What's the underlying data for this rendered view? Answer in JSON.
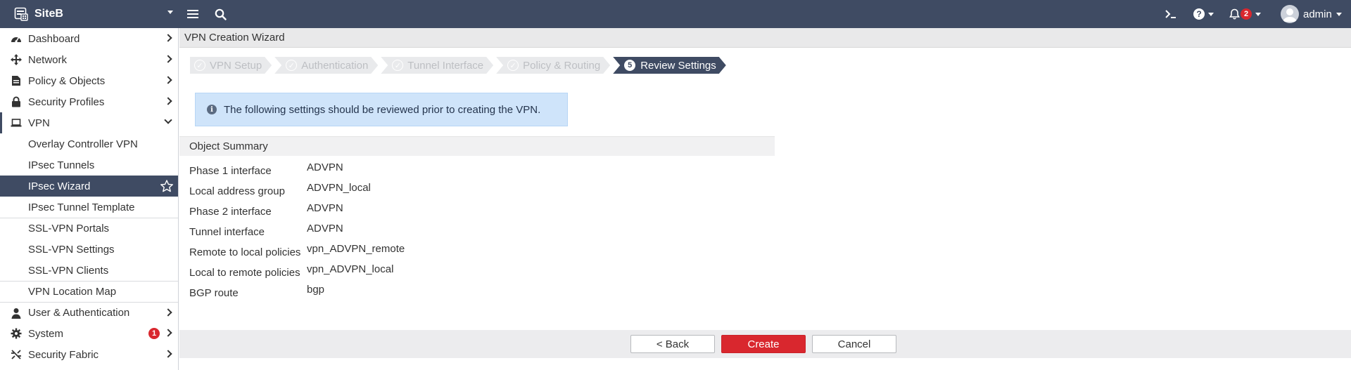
{
  "topbar": {
    "site_name": "SiteB",
    "notification_count": "2",
    "user_name": "admin"
  },
  "sidebar": {
    "items": [
      {
        "label": "Dashboard",
        "icon": "dashboard-icon"
      },
      {
        "label": "Network",
        "icon": "network-icon"
      },
      {
        "label": "Policy & Objects",
        "icon": "policy-icon"
      },
      {
        "label": "Security Profiles",
        "icon": "lock-icon"
      },
      {
        "label": "VPN",
        "icon": "laptop-icon"
      }
    ],
    "vpn_sub": [
      "Overlay Controller VPN",
      "IPsec Tunnels",
      "IPsec Wizard",
      "IPsec Tunnel Template",
      "SSL-VPN Portals",
      "SSL-VPN Settings",
      "SSL-VPN Clients",
      "VPN Location Map"
    ],
    "bottom_items": [
      {
        "label": "User & Authentication",
        "icon": "user-icon"
      },
      {
        "label": "System",
        "icon": "gear-icon",
        "badge": "1"
      },
      {
        "label": "Security Fabric",
        "icon": "fabric-icon"
      }
    ]
  },
  "main": {
    "page_title": "VPN Creation Wizard",
    "steps": [
      {
        "label": "VPN Setup",
        "done": true
      },
      {
        "label": "Authentication",
        "done": true
      },
      {
        "label": "Tunnel Interface",
        "done": true
      },
      {
        "label": "Policy & Routing",
        "done": true
      },
      {
        "label": "Review Settings",
        "number": "5",
        "current": true
      }
    ],
    "info_message": "The following settings should be reviewed prior to creating the VPN.",
    "summary_title": "Object Summary",
    "summary": [
      {
        "key": "Phase 1 interface",
        "value": "ADVPN"
      },
      {
        "key": "Local address group",
        "value": "ADVPN_local"
      },
      {
        "key": "Phase 2 interface",
        "value": "ADVPN"
      },
      {
        "key": "Tunnel interface",
        "value": "ADVPN"
      },
      {
        "key": "Remote to local policies",
        "value": "vpn_ADVPN_remote"
      },
      {
        "key": "Local to remote policies",
        "value": "vpn_ADVPN_local"
      },
      {
        "key": "BGP route",
        "value": "bgp"
      }
    ],
    "buttons": {
      "back": "< Back",
      "create": "Create",
      "cancel": "Cancel"
    }
  },
  "colors": {
    "topbar": "#3f4b63",
    "primary_button": "#d9272e",
    "info_bg": "#cfe4fa"
  }
}
